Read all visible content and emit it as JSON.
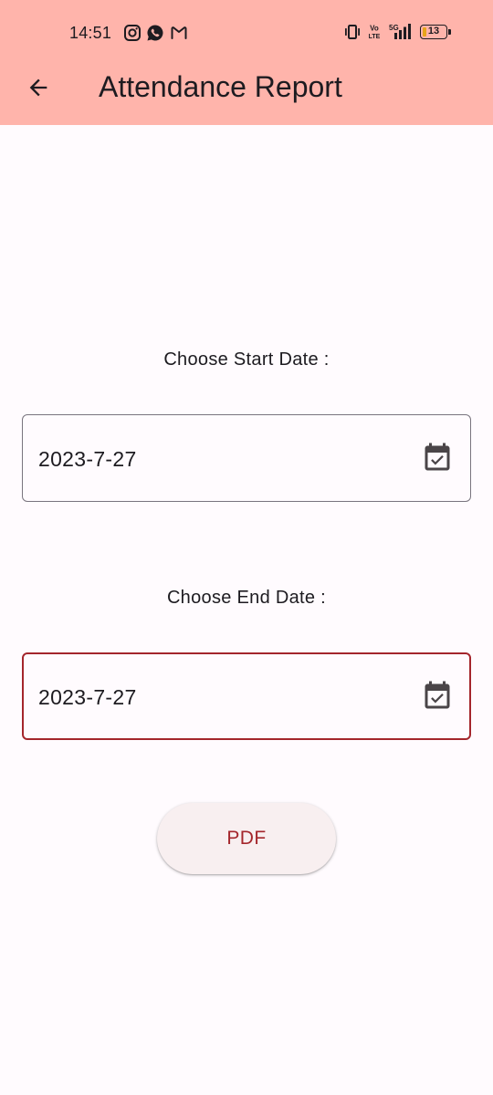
{
  "status_bar": {
    "time": "14:51",
    "left_icons": [
      "instagram-icon",
      "whatsapp-icon",
      "gmail-icon"
    ],
    "right_icons": [
      "vibrate-icon",
      "volte-icon",
      "5g-signal-icon",
      "battery-icon"
    ],
    "volte_label_top": "Vo",
    "volte_label_bottom": "LTE",
    "network_label": "5G",
    "battery_level": "13",
    "battery_accent": "#e7a51a"
  },
  "app_bar": {
    "title": "Attendance Report",
    "background": "#ffb4ab",
    "back_icon": "arrow-left-icon"
  },
  "form": {
    "start_date": {
      "label": "Choose Start Date :",
      "value": "2023-7-27",
      "icon": "calendar-check-icon"
    },
    "end_date": {
      "label": "Choose End Date :",
      "value": "2023-7-27",
      "icon": "calendar-check-icon",
      "focused": true
    },
    "submit_label": "PDF"
  },
  "colors": {
    "accent": "#a4262c",
    "outline": "#79747e",
    "background": "#fffbfe",
    "button_background": "#f8eff0"
  }
}
